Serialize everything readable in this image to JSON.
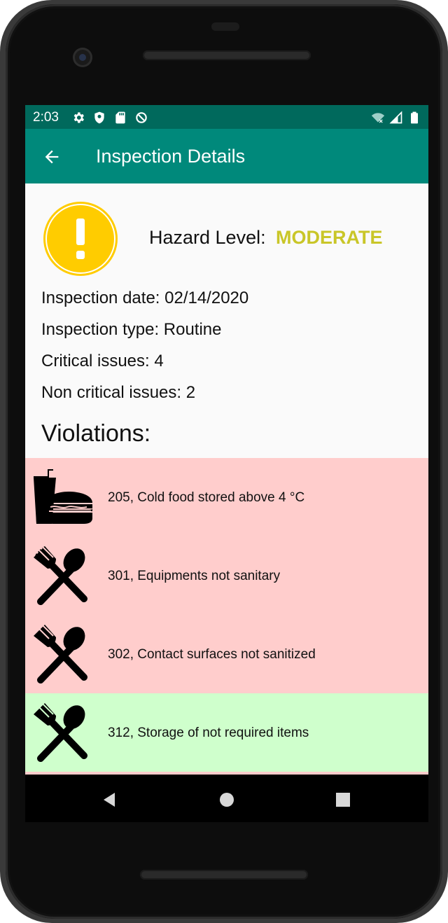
{
  "status": {
    "time": "2:03",
    "icons_left": [
      "gear-icon",
      "shield-icon",
      "sd-card-icon",
      "sync-off-icon"
    ],
    "icons_right": [
      "wifi-off-icon",
      "cell-signal-icon",
      "battery-icon"
    ]
  },
  "appbar": {
    "back_icon": "arrow-back-icon",
    "title": "Inspection Details"
  },
  "inspection": {
    "hazard_icon": "exclamation-warning-icon",
    "hazard_label": "Hazard Level:",
    "hazard_value": "MODERATE",
    "hazard_color": "#c9c628",
    "date": "Inspection date: 02/14/2020",
    "type": "Inspection type: Routine",
    "critical": "Critical issues: 4",
    "non_critical": "Non critical issues: 2",
    "violations_title": "Violations:"
  },
  "violations": [
    {
      "text": "205, Cold food stored above 4 °C",
      "icon": "fast-food-icon",
      "severity": "critical",
      "color": "#ffcdcc"
    },
    {
      "text": "301, Equipments not sanitary",
      "icon": "utensils-icon",
      "severity": "critical",
      "color": "#ffcdcc"
    },
    {
      "text": "302, Contact surfaces not sanitized",
      "icon": "utensils-icon",
      "severity": "critical",
      "color": "#ffcdcc"
    },
    {
      "text": "312, Storage of not required items",
      "icon": "utensils-icon",
      "severity": "non-critical",
      "color": "#cfffcc"
    }
  ],
  "navbar": {
    "icons": [
      "back-triangle-icon",
      "home-circle-icon",
      "recents-square-icon"
    ]
  }
}
